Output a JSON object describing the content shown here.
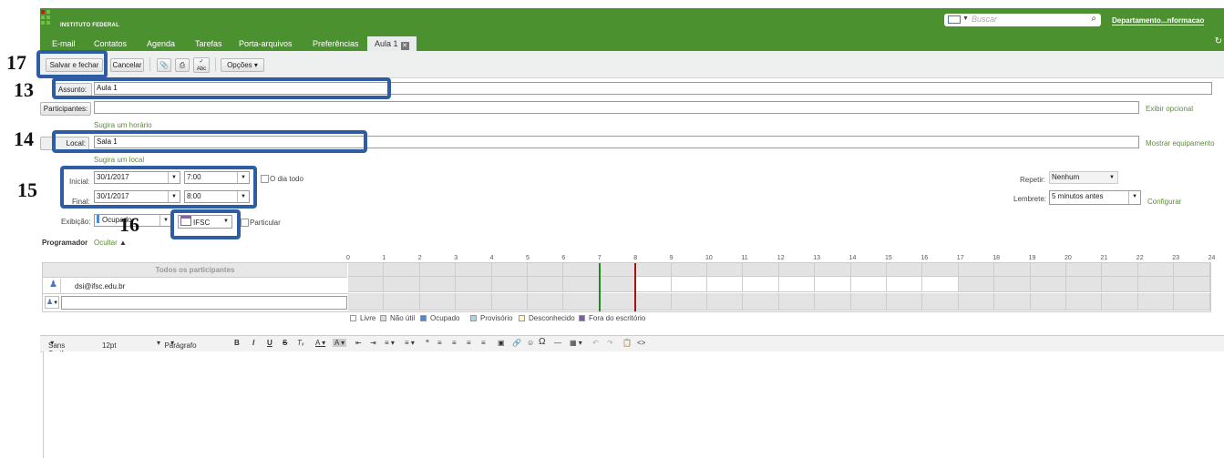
{
  "header": {
    "brand": "INSTITUTO FEDERAL",
    "search_placeholder": "Buscar",
    "user": "Departamento...nformacao"
  },
  "tabs": [
    {
      "label": "E-mail"
    },
    {
      "label": "Contatos"
    },
    {
      "label": "Agenda"
    },
    {
      "label": "Tarefas"
    },
    {
      "label": "Porta-arquivos"
    },
    {
      "label": "Preferências"
    }
  ],
  "active_tab": {
    "label": "Aula 1"
  },
  "toolbar": {
    "save_label": "Salvar e fechar",
    "cancel_label": "Cancelar",
    "options_label": "Opções"
  },
  "form": {
    "subject_label": "Assunto:",
    "subject_value": "Aula 1",
    "participants_label": "Participantes:",
    "show_optional": "Exibir opcional",
    "suggest_time": "Sugira um horário",
    "location_label": "Local:",
    "location_value": "Sala 1",
    "show_equipment": "Mostrar equipamento",
    "suggest_location": "Sugira um local",
    "start_label": "Inicial:",
    "start_date": "30/1/2017",
    "start_time": "7:00",
    "end_label": "Final:",
    "end_date": "30/1/2017",
    "end_time": "8:00",
    "all_day": "O dia todo",
    "repeat_label": "Repetir:",
    "repeat_value": "Nenhum",
    "reminder_label": "Lembrete:",
    "reminder_value": "5 minutos antes",
    "configure": "Configurar",
    "display_label": "Exibição:",
    "display_value": "Ocupado",
    "calendar_value": "IFSC",
    "private_label": "Particular"
  },
  "scheduler": {
    "title": "Programador",
    "hide": "Ocultar",
    "all_participants": "Todos os participantes",
    "attendee": "dsi@ifsc.edu.br",
    "hours": [
      "0",
      "1",
      "2",
      "3",
      "4",
      "5",
      "6",
      "7",
      "8",
      "9",
      "10",
      "11",
      "12",
      "13",
      "14",
      "15",
      "16",
      "17",
      "18",
      "19",
      "20",
      "21",
      "22",
      "23",
      "24"
    ],
    "legend": [
      {
        "label": "Livre",
        "color": "#ffffff"
      },
      {
        "label": "Não útil",
        "color": "#d8d8d8"
      },
      {
        "label": "Ocupado",
        "color": "#4a8ad4"
      },
      {
        "label": "Provisório",
        "color": "#a9d4ea"
      },
      {
        "label": "Desconhecido",
        "color": "#fff7c8"
      },
      {
        "label": "Fora do escritório",
        "color": "#7d5ba6"
      }
    ]
  },
  "editor": {
    "font": "Sans Serif",
    "size": "12pt",
    "format": "Parágrafo"
  },
  "annotations": {
    "n13": "13",
    "n14": "14",
    "n15": "15",
    "n16": "16",
    "n17": "17"
  },
  "colors": {
    "brand_green": "#4c9130",
    "highlight_blue": "#2f5da3",
    "start_marker": "#1f8a1f",
    "end_marker": "#a01414"
  }
}
